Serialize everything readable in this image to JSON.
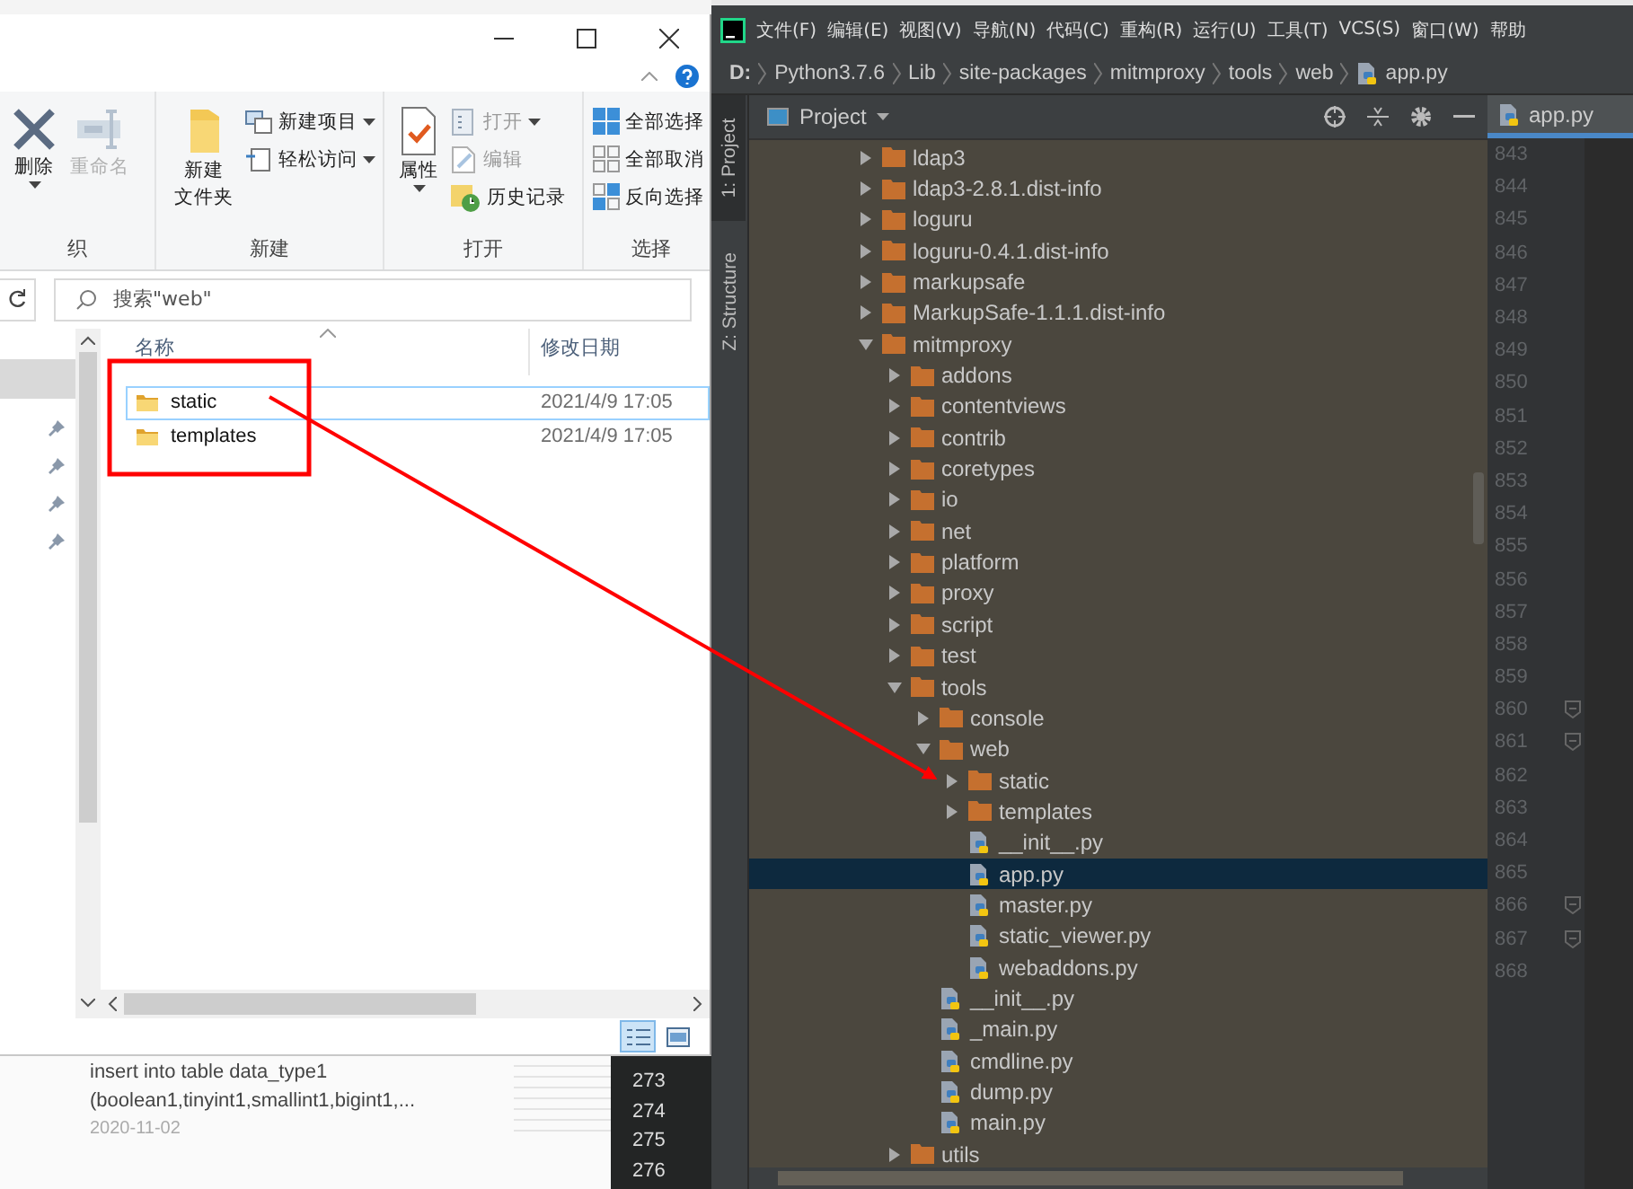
{
  "explorer": {
    "ribbon_groups": [
      {
        "label": "织",
        "items": [
          {
            "kind": "large",
            "lines": [
              "删除"
            ],
            "dropdown": true,
            "disabled": false
          },
          {
            "kind": "large",
            "lines": [
              "重命名"
            ],
            "dropdown": false,
            "disabled": true
          }
        ]
      },
      {
        "label": "新建",
        "items": [
          {
            "kind": "large",
            "lines": [
              "新建",
              "文件夹"
            ],
            "dropdown": false,
            "disabled": false
          },
          {
            "kind": "small",
            "label": "新建项目",
            "dropdown": true,
            "disabled": false
          },
          {
            "kind": "small",
            "label": "轻松访问",
            "dropdown": true,
            "disabled": false
          }
        ]
      },
      {
        "label": "打开",
        "items": [
          {
            "kind": "large",
            "lines": [
              "属性"
            ],
            "dropdown": true,
            "disabled": false
          },
          {
            "kind": "small",
            "label": "打开",
            "dropdown": true,
            "disabled": true
          },
          {
            "kind": "small",
            "label": "编辑",
            "dropdown": false,
            "disabled": true
          },
          {
            "kind": "small",
            "label": "历史记录",
            "dropdown": false,
            "disabled": false
          }
        ]
      },
      {
        "label": "选择",
        "items": [
          {
            "kind": "small",
            "label": "全部选择",
            "dropdown": false,
            "disabled": false
          },
          {
            "kind": "small",
            "label": "全部取消",
            "dropdown": false,
            "disabled": false
          },
          {
            "kind": "small",
            "label": "反向选择",
            "dropdown": false,
            "disabled": false
          }
        ]
      }
    ],
    "search": {
      "placeholder": "搜索\"web\""
    },
    "columns": [
      "名称",
      "修改日期"
    ],
    "files": [
      {
        "name": "static",
        "modified": "2021/4/9 17:05",
        "selected": true
      },
      {
        "name": "templates",
        "modified": "2021/4/9 17:05",
        "selected": false
      }
    ]
  },
  "background_page": {
    "title": "insert into table data_type1",
    "snippet": "(boolean1,tinyint1,smallint1,bigint1,...",
    "date": "2020-11-02",
    "code_lines": [
      "273",
      "274",
      "275",
      "276"
    ]
  },
  "ide": {
    "menu": [
      "文件(F)",
      "编辑(E)",
      "视图(V)",
      "导航(N)",
      "代码(C)",
      "重构(R)",
      "运行(U)",
      "工具(T)",
      "VCS(S)",
      "窗口(W)",
      "帮助"
    ],
    "breadcrumbs": [
      {
        "label": "D:",
        "kind": "folder"
      },
      {
        "label": "Python3.7.6",
        "kind": "folder"
      },
      {
        "label": "Lib",
        "kind": "folder"
      },
      {
        "label": "site-packages",
        "kind": "folder"
      },
      {
        "label": "mitmproxy",
        "kind": "folder"
      },
      {
        "label": "tools",
        "kind": "folder"
      },
      {
        "label": "web",
        "kind": "folder"
      },
      {
        "label": "app.py",
        "kind": "python_file"
      }
    ],
    "side_tabs": [
      {
        "label": "1: Project",
        "selected": true
      },
      {
        "label": "Z: Structure",
        "selected": false
      }
    ],
    "panel_title": "Project",
    "editor_tab": "app.py",
    "tree": [
      {
        "name": "ldap3",
        "kind": "folder",
        "expanded": false,
        "selected": false
      },
      {
        "name": "ldap3-2.8.1.dist-info",
        "kind": "folder",
        "expanded": false,
        "selected": false
      },
      {
        "name": "loguru",
        "kind": "folder",
        "expanded": false,
        "selected": false
      },
      {
        "name": "loguru-0.4.1.dist-info",
        "kind": "folder",
        "expanded": false,
        "selected": false
      },
      {
        "name": "markupsafe",
        "kind": "folder",
        "expanded": false,
        "selected": false
      },
      {
        "name": "MarkupSafe-1.1.1.dist-info",
        "kind": "folder",
        "expanded": false,
        "selected": false
      },
      {
        "name": "mitmproxy",
        "kind": "folder",
        "expanded": true,
        "selected": false,
        "children": [
          {
            "name": "addons",
            "kind": "folder",
            "expanded": false,
            "selected": false
          },
          {
            "name": "contentviews",
            "kind": "folder",
            "expanded": false,
            "selected": false
          },
          {
            "name": "contrib",
            "kind": "folder",
            "expanded": false,
            "selected": false
          },
          {
            "name": "coretypes",
            "kind": "folder",
            "expanded": false,
            "selected": false
          },
          {
            "name": "io",
            "kind": "folder",
            "expanded": false,
            "selected": false
          },
          {
            "name": "net",
            "kind": "folder",
            "expanded": false,
            "selected": false
          },
          {
            "name": "platform",
            "kind": "folder",
            "expanded": false,
            "selected": false
          },
          {
            "name": "proxy",
            "kind": "folder",
            "expanded": false,
            "selected": false
          },
          {
            "name": "script",
            "kind": "folder",
            "expanded": false,
            "selected": false
          },
          {
            "name": "test",
            "kind": "folder",
            "expanded": false,
            "selected": false
          },
          {
            "name": "tools",
            "kind": "folder",
            "expanded": true,
            "selected": false,
            "children": [
              {
                "name": "console",
                "kind": "folder",
                "expanded": false,
                "selected": false
              },
              {
                "name": "web",
                "kind": "folder",
                "expanded": true,
                "selected": false,
                "children": [
                  {
                    "name": "static",
                    "kind": "folder",
                    "expanded": false,
                    "selected": false
                  },
                  {
                    "name": "templates",
                    "kind": "folder",
                    "expanded": false,
                    "selected": false
                  },
                  {
                    "name": "__init__.py",
                    "kind": "python_file",
                    "selected": false
                  },
                  {
                    "name": "app.py",
                    "kind": "python_file",
                    "selected": true
                  },
                  {
                    "name": "master.py",
                    "kind": "python_file",
                    "selected": false
                  },
                  {
                    "name": "static_viewer.py",
                    "kind": "python_file",
                    "selected": false
                  },
                  {
                    "name": "webaddons.py",
                    "kind": "python_file",
                    "selected": false
                  }
                ]
              },
              {
                "name": "__init__.py",
                "kind": "python_file",
                "selected": false
              },
              {
                "name": "_main.py",
                "kind": "python_file",
                "selected": false
              },
              {
                "name": "cmdline.py",
                "kind": "python_file",
                "selected": false
              },
              {
                "name": "dump.py",
                "kind": "python_file",
                "selected": false
              },
              {
                "name": "main.py",
                "kind": "python_file",
                "selected": false
              }
            ]
          },
          {
            "name": "utils",
            "kind": "folder",
            "expanded": false,
            "selected": false
          }
        ]
      }
    ],
    "line_numbers": [
      {
        "n": "843",
        "fold": false
      },
      {
        "n": "844",
        "fold": false
      },
      {
        "n": "845",
        "fold": false
      },
      {
        "n": "846",
        "fold": false
      },
      {
        "n": "847",
        "fold": false
      },
      {
        "n": "848",
        "fold": false
      },
      {
        "n": "849",
        "fold": false
      },
      {
        "n": "850",
        "fold": false
      },
      {
        "n": "851",
        "fold": false
      },
      {
        "n": "852",
        "fold": false
      },
      {
        "n": "853",
        "fold": false
      },
      {
        "n": "854",
        "fold": false
      },
      {
        "n": "855",
        "fold": false
      },
      {
        "n": "856",
        "fold": false
      },
      {
        "n": "857",
        "fold": false
      },
      {
        "n": "858",
        "fold": false
      },
      {
        "n": "859",
        "fold": false
      },
      {
        "n": "860",
        "fold": true
      },
      {
        "n": "861",
        "fold": true
      },
      {
        "n": "862",
        "fold": false
      },
      {
        "n": "863",
        "fold": false
      },
      {
        "n": "864",
        "fold": false
      },
      {
        "n": "865",
        "fold": false
      },
      {
        "n": "866",
        "fold": true
      },
      {
        "n": "867",
        "fold": true
      },
      {
        "n": "868",
        "fold": false
      }
    ]
  }
}
